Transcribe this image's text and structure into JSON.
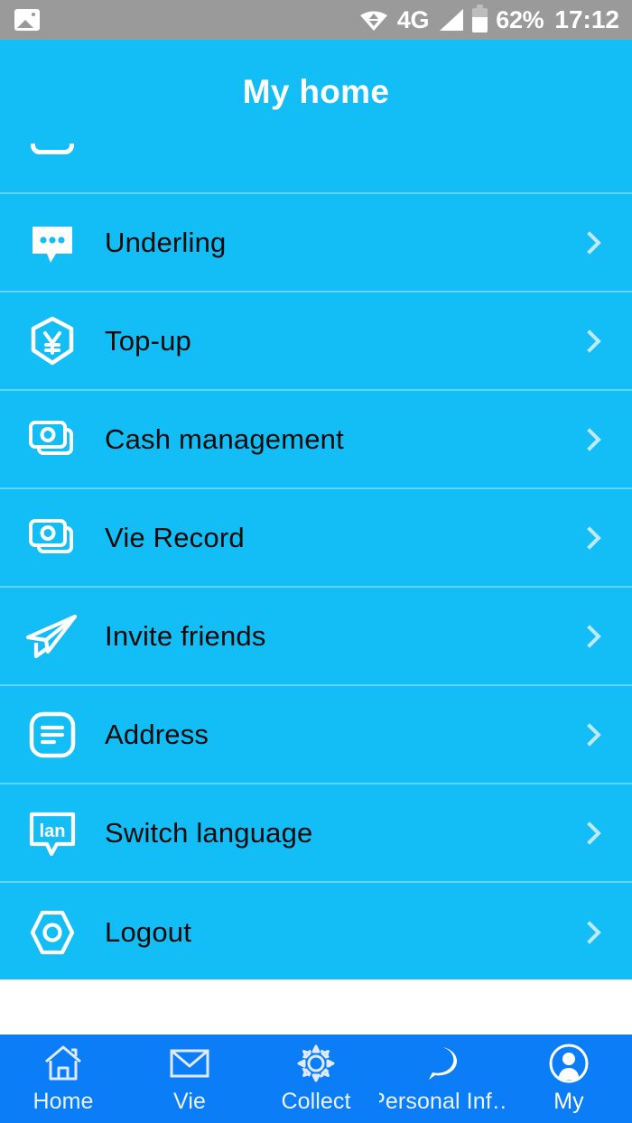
{
  "status_bar": {
    "photo_icon": "photo-icon",
    "wifi_icon": "wifi-icon",
    "network_label": "4G",
    "signal_icon": "signal-bars-icon",
    "battery_icon": "battery-icon",
    "battery_percent": "62%",
    "time": "17:12",
    "background_color": "#9a9a9a"
  },
  "header": {
    "title": "My home",
    "background_color": "#13BDF5",
    "title_color": "#ffffff"
  },
  "list": {
    "background_color": "#13BDF5",
    "divider_color": "#62d4f8",
    "label_color": "#0a0a0a",
    "chevron_color": "#bfeafd",
    "partial_top_item": {
      "icon": "cup-bottom-icon",
      "label": ""
    },
    "items": [
      {
        "icon": "chat-bubble-dots-icon",
        "label": "Underling",
        "chevron": "chevron-right-icon"
      },
      {
        "icon": "shield-yuan-icon",
        "label": "Top-up",
        "chevron": "chevron-right-icon"
      },
      {
        "icon": "banknotes-icon",
        "label": "Cash management",
        "chevron": "chevron-right-icon"
      },
      {
        "icon": "banknotes-icon",
        "label": "Vie Record",
        "chevron": "chevron-right-icon"
      },
      {
        "icon": "paper-plane-icon",
        "label": "Invite friends",
        "chevron": "chevron-right-icon"
      },
      {
        "icon": "document-lines-icon",
        "label": "Address",
        "chevron": "chevron-right-icon"
      },
      {
        "icon": "language-bubble-icon",
        "label": "Switch language",
        "chevron": "chevron-right-icon"
      },
      {
        "icon": "hex-nut-icon",
        "label": "Logout",
        "chevron": "chevron-right-icon"
      }
    ]
  },
  "bottom_nav": {
    "background_color": "#0B7DF7",
    "label_color": "#eaf2ff",
    "items": [
      {
        "icon": "home-icon",
        "label": "Home",
        "active": false
      },
      {
        "icon": "envelope-icon",
        "label": "Vie",
        "active": false
      },
      {
        "icon": "gear-icon",
        "label": "Collect",
        "active": false
      },
      {
        "icon": "chat-dots-icon",
        "label": "Personal Inf…",
        "active": false
      },
      {
        "icon": "user-avatar-icon",
        "label": "My",
        "active": true
      }
    ]
  }
}
